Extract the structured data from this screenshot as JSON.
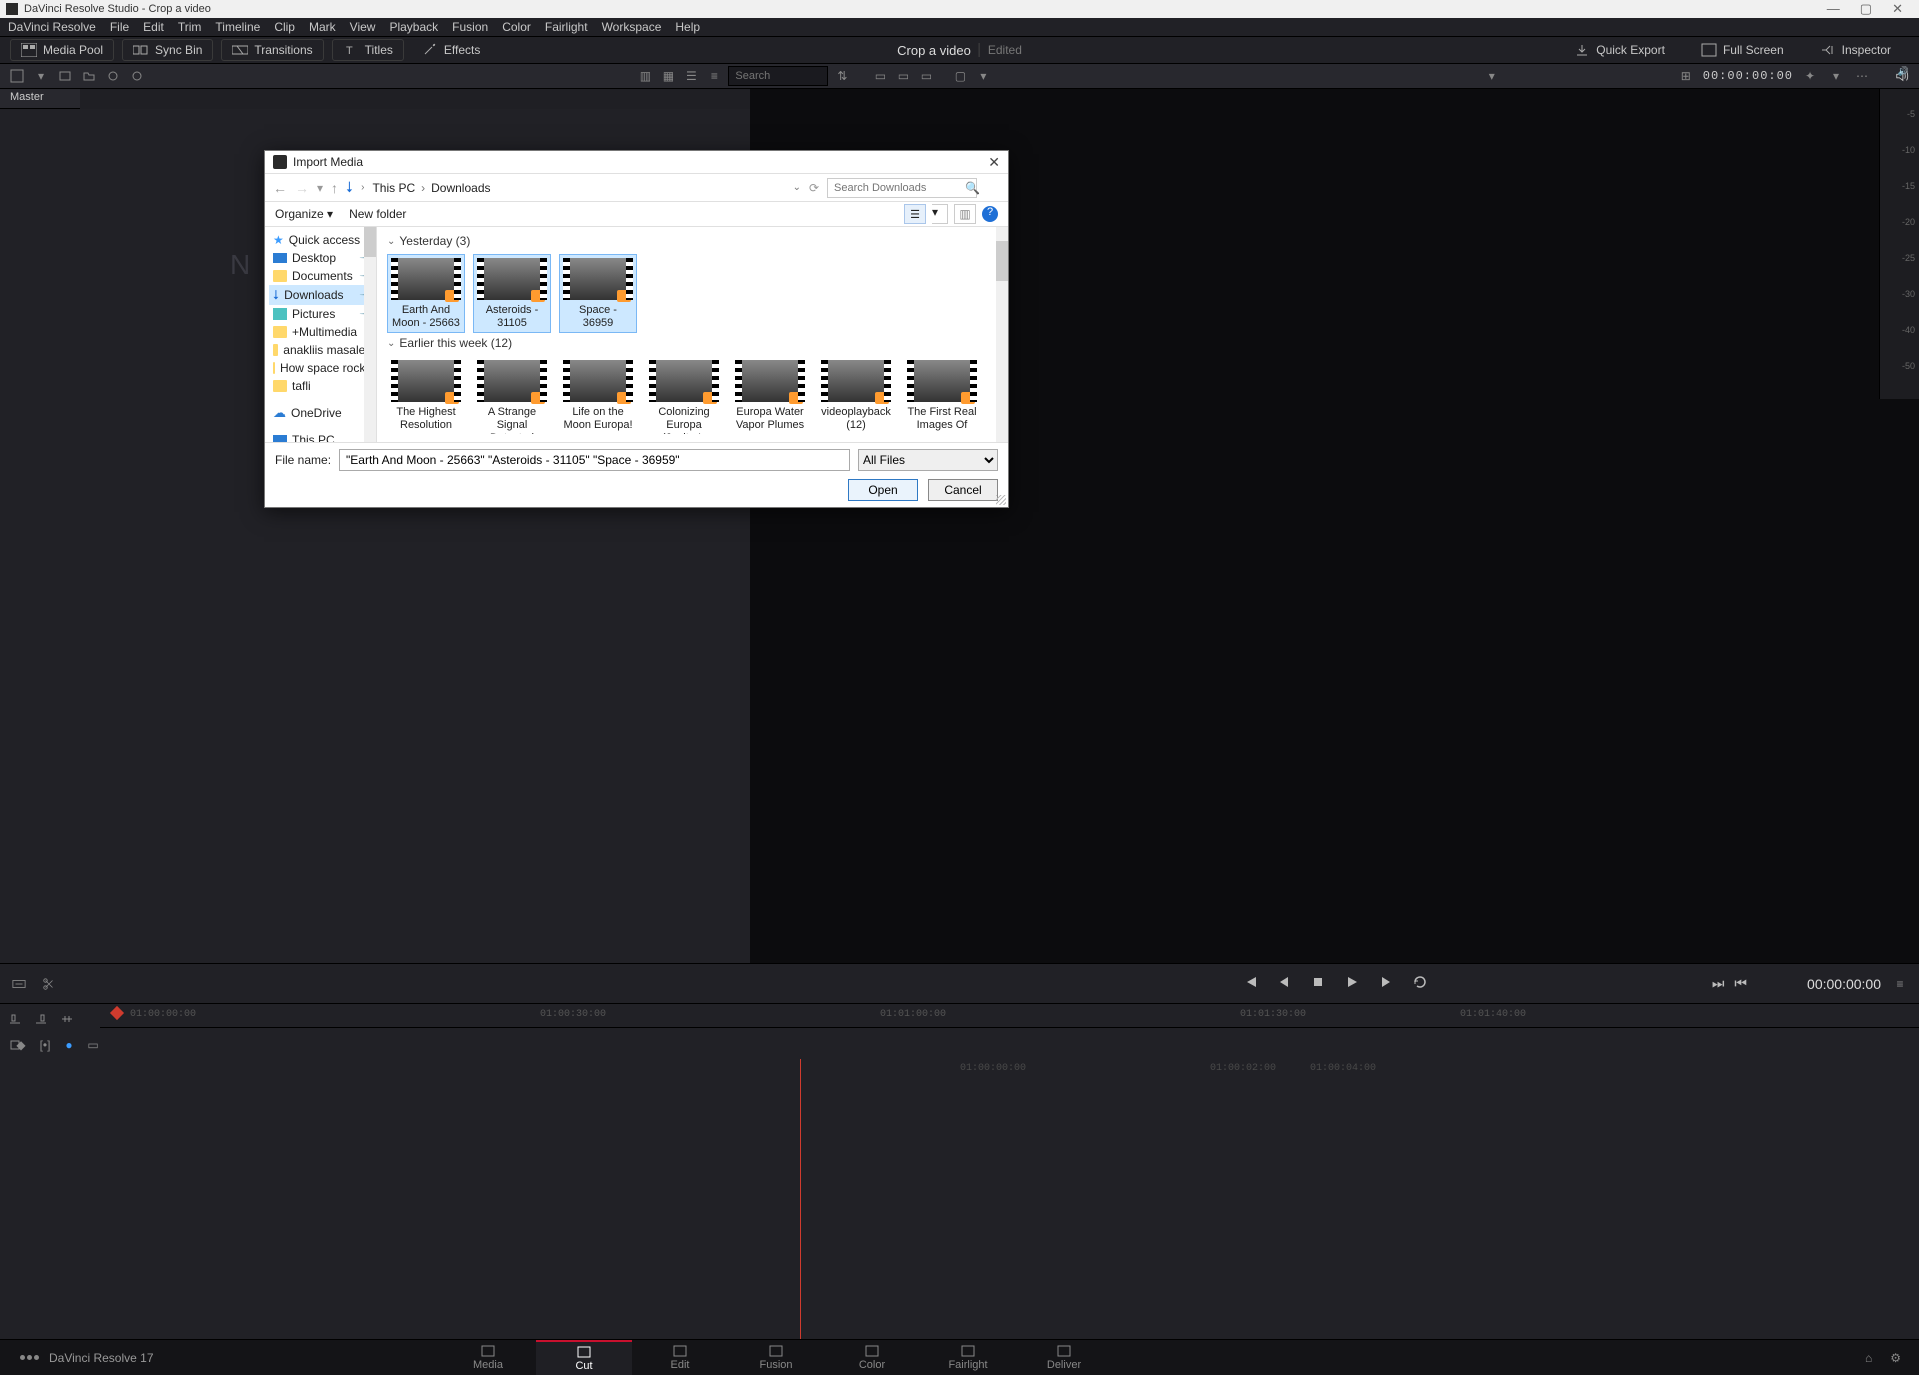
{
  "titlebar": {
    "text": "DaVinci Resolve Studio - Crop a video"
  },
  "menu": [
    "DaVinci Resolve",
    "File",
    "Edit",
    "Trim",
    "Timeline",
    "Clip",
    "Mark",
    "View",
    "Playback",
    "Fusion",
    "Color",
    "Fairlight",
    "Workspace",
    "Help"
  ],
  "workspace": {
    "buttons": {
      "media_pool": "Media Pool",
      "sync_bin": "Sync Bin",
      "transitions": "Transitions",
      "titles": "Titles",
      "effects": "Effects"
    },
    "project": "Crop a video",
    "project_sub": "Edited",
    "right": {
      "quick_export": "Quick Export",
      "full_screen": "Full Screen",
      "inspector": "Inspector"
    }
  },
  "subbar": {
    "search_ph": "Search",
    "tc": "00:00:00:00"
  },
  "media_panel": {
    "tab": "Master",
    "placeholder": "N"
  },
  "level_ticks": [
    "-5",
    "-10",
    "-15",
    "-20",
    "-25",
    "-30",
    "-40",
    "-50"
  ],
  "transport": {
    "tc": "00:00:00:00"
  },
  "ruler_top": [
    "01:00:00:00",
    "01:00:30:00",
    "01:01:00:00",
    "01:01:30:00",
    "01:01:40:00"
  ],
  "timeline_ticks": [
    "01:00:00:00",
    "01:00:02:00",
    "01:00:04:00"
  ],
  "bottom": {
    "brand": "DaVinci Resolve 17",
    "pages": [
      {
        "id": "media",
        "label": "Media"
      },
      {
        "id": "cut",
        "label": "Cut"
      },
      {
        "id": "edit",
        "label": "Edit"
      },
      {
        "id": "fusion",
        "label": "Fusion"
      },
      {
        "id": "color",
        "label": "Color"
      },
      {
        "id": "fairlight",
        "label": "Fairlight"
      },
      {
        "id": "deliver",
        "label": "Deliver"
      }
    ],
    "active": "cut"
  },
  "modal": {
    "title": "Import Media",
    "crumbs": [
      "This PC",
      "Downloads"
    ],
    "search_ph": "Search Downloads",
    "toolbar": {
      "organize": "Organize",
      "newfolder": "New folder"
    },
    "sidebar": [
      {
        "icon": "star",
        "label": "Quick access"
      },
      {
        "icon": "mon",
        "label": "Desktop",
        "pin": true
      },
      {
        "icon": "fold",
        "label": "Documents",
        "pin": true
      },
      {
        "icon": "dl",
        "label": "Downloads",
        "pin": true,
        "active": true
      },
      {
        "icon": "pic",
        "label": "Pictures",
        "pin": true
      },
      {
        "icon": "fold",
        "label": "+Multimedia"
      },
      {
        "icon": "fold",
        "label": "anakliis masaleb"
      },
      {
        "icon": "fold",
        "label": "How space rocke"
      },
      {
        "icon": "fold",
        "label": "tafli"
      },
      {
        "icon": "cloud",
        "label": "OneDrive",
        "spaced": true
      },
      {
        "icon": "mon",
        "label": "This PC",
        "spaced": true
      }
    ],
    "groups": [
      {
        "header": "Yesterday (3)",
        "items": [
          {
            "label": "Earth And Moon - 25663",
            "sel": true
          },
          {
            "label": "Asteroids - 31105",
            "sel": true
          },
          {
            "label": "Space - 36959",
            "sel": true
          }
        ]
      },
      {
        "header": "Earlier this week (12)",
        "items": [
          {
            "label": "The Highest Resolution"
          },
          {
            "label": "A Strange Signal Detected From"
          },
          {
            "label": "Life on the Moon Europa!"
          },
          {
            "label": "Colonizing Europa (Jupiter's"
          },
          {
            "label": "Europa Water Vapor Plumes -"
          },
          {
            "label": "videoplayback (12)"
          },
          {
            "label": "The First Real Images Of"
          }
        ]
      }
    ],
    "filename_label": "File name:",
    "filename_value": "\"Earth And Moon - 25663\" \"Asteroids - 31105\" \"Space - 36959\"",
    "filter": "All Files",
    "open": "Open",
    "cancel": "Cancel"
  }
}
